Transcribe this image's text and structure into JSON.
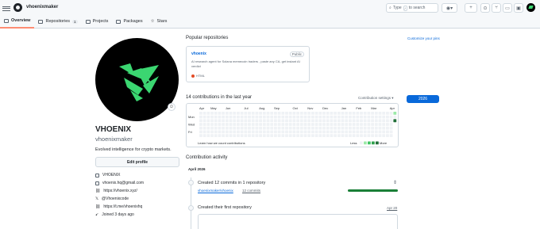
{
  "header": {
    "username": "vhoenixmaker",
    "search_placeholder": "Type",
    "search_key": "/",
    "search_suffix": "to search",
    "plus": "+"
  },
  "tabs": [
    {
      "label": "Overview"
    },
    {
      "label": "Repositories",
      "count": "1"
    },
    {
      "label": "Projects"
    },
    {
      "label": "Packages"
    },
    {
      "label": "Stars"
    }
  ],
  "profile": {
    "name": "VHOENIX",
    "login": "vhoenixmaker",
    "bio": "Evolved intelligence for crypto markets.",
    "edit": "Edit profile",
    "emoji": "☺",
    "details": [
      "VHOENIX",
      "vhoenix.hq@gmail.com",
      "https://vhoenix.xyz/",
      "@Vhoenixcode",
      "https://t.me/vhoenixhq",
      "Joined 3 days ago"
    ]
  },
  "popular": {
    "title": "Popular repositories",
    "customize": "Customize your pins",
    "repo": {
      "name": "vhoenix",
      "visibility": "Public",
      "description": "AI research agent for Solana memecoin traders , paste any CA, get instant AI verdict",
      "language": "HTML",
      "language_color": "#e34c26"
    }
  },
  "contrib": {
    "title": "14 contributions in the last year",
    "settings": "Contribution settings ▾",
    "year": "2026",
    "months": [
      "Apr",
      "May",
      "Jun",
      "Jul",
      "Aug",
      "Sep",
      "Oct",
      "Nov",
      "Dec",
      "Jan",
      "Feb",
      "Mar",
      "Apr"
    ],
    "days": [
      "Mon",
      "Wed",
      "Fri"
    ],
    "learn": "Learn how we count contributions",
    "less": "Less",
    "more": "More"
  },
  "activity": {
    "title": "Contribution activity",
    "month": "April 2026",
    "item1": {
      "title": "Created 12 commits in 1 repository",
      "repo": "vhoenixmaker/vhoenix",
      "commits": "12 commits"
    },
    "item2": {
      "title": "Created their first repository",
      "date": "Apr 20"
    }
  }
}
